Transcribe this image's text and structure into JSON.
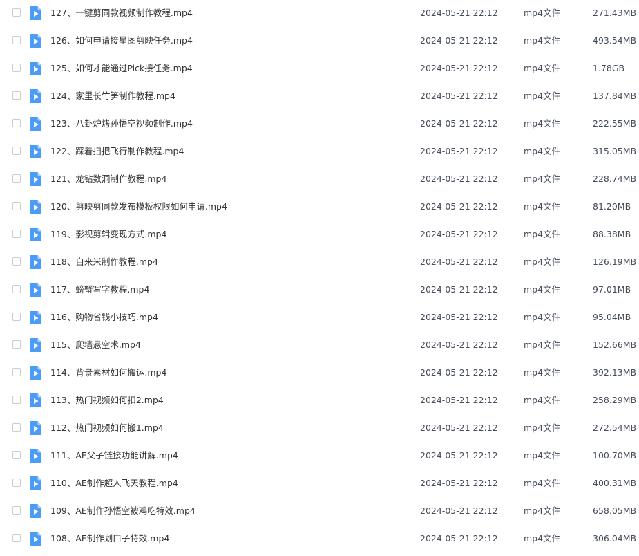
{
  "files": [
    {
      "name": "127、一键剪同款视频制作教程.mp4",
      "date": "2024-05-21 22:12",
      "type": "mp4文件",
      "size": "271.43MB"
    },
    {
      "name": "126、如何申请接星图剪映任务.mp4",
      "date": "2024-05-21 22:12",
      "type": "mp4文件",
      "size": "493.54MB"
    },
    {
      "name": "125、如何才能通过Pick接任务.mp4",
      "date": "2024-05-21 22:12",
      "type": "mp4文件",
      "size": "1.78GB"
    },
    {
      "name": "124、家里长竹笋制作教程.mp4",
      "date": "2024-05-21 22:12",
      "type": "mp4文件",
      "size": "137.84MB"
    },
    {
      "name": "123、八卦炉烤孙悟空视频制作.mp4",
      "date": "2024-05-21 22:12",
      "type": "mp4文件",
      "size": "222.55MB"
    },
    {
      "name": "122、踩着扫把飞行制作教程.mp4",
      "date": "2024-05-21 22:12",
      "type": "mp4文件",
      "size": "315.05MB"
    },
    {
      "name": "121、龙钻数洞制作教程.mp4",
      "date": "2024-05-21 22:12",
      "type": "mp4文件",
      "size": "228.74MB"
    },
    {
      "name": "120、剪映剪同款发布模板权限如何申请.mp4",
      "date": "2024-05-21 22:12",
      "type": "mp4文件",
      "size": "81.20MB"
    },
    {
      "name": "119、影视剪辑变现方式.mp4",
      "date": "2024-05-21 22:12",
      "type": "mp4文件",
      "size": "88.38MB"
    },
    {
      "name": "118、自来米制作教程.mp4",
      "date": "2024-05-21 22:12",
      "type": "mp4文件",
      "size": "126.19MB"
    },
    {
      "name": "117、螃蟹写字教程.mp4",
      "date": "2024-05-21 22:12",
      "type": "mp4文件",
      "size": "97.01MB"
    },
    {
      "name": "116、购物省钱小技巧.mp4",
      "date": "2024-05-21 22:12",
      "type": "mp4文件",
      "size": "95.04MB"
    },
    {
      "name": "115、爬墙悬空术.mp4",
      "date": "2024-05-21 22:12",
      "type": "mp4文件",
      "size": "152.66MB"
    },
    {
      "name": "114、背景素材如何搬运.mp4",
      "date": "2024-05-21 22:12",
      "type": "mp4文件",
      "size": "392.13MB"
    },
    {
      "name": "113、热门视频如何扣2.mp4",
      "date": "2024-05-21 22:12",
      "type": "mp4文件",
      "size": "258.29MB"
    },
    {
      "name": "112、热门视频如何搬1.mp4",
      "date": "2024-05-21 22:12",
      "type": "mp4文件",
      "size": "272.54MB"
    },
    {
      "name": "111、AE父子链接功能讲解.mp4",
      "date": "2024-05-21 22:12",
      "type": "mp4文件",
      "size": "100.70MB"
    },
    {
      "name": "110、AE制作超人飞天教程.mp4",
      "date": "2024-05-21 22:12",
      "type": "mp4文件",
      "size": "400.31MB"
    },
    {
      "name": "109、AE制作孙悟空被鸡吃特效.mp4",
      "date": "2024-05-21 22:12",
      "type": "mp4文件",
      "size": "658.05MB"
    },
    {
      "name": "108、AE制作划口子特效.mp4",
      "date": "2024-05-21 22:12",
      "type": "mp4文件",
      "size": "306.04MB"
    }
  ],
  "icon": "video-file-icon",
  "colors": {
    "icon_blue": "#4a9cf6",
    "icon_fold": "#a9d0fb",
    "checkbox_border": "#c9cdd4",
    "text": "#333333",
    "meta_text": "#454d5a"
  }
}
